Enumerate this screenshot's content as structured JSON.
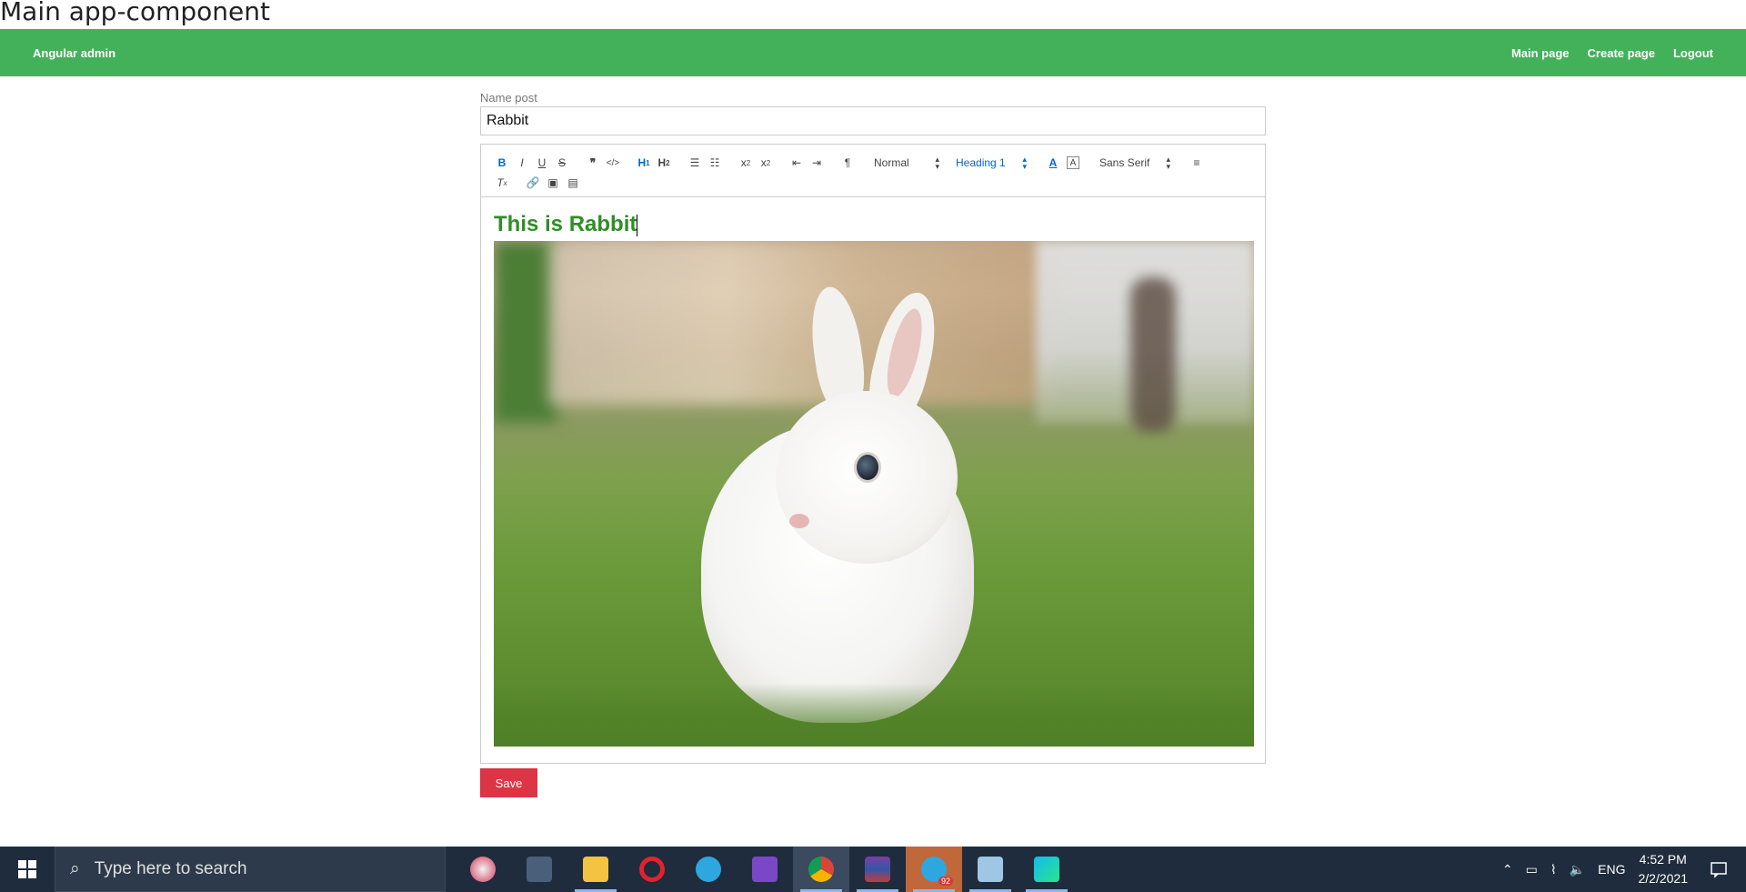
{
  "page": {
    "heading": "Main app-component"
  },
  "navbar": {
    "brand": "Angular admin",
    "links": [
      "Main page",
      "Create page",
      "Logout"
    ],
    "color": "#42b15a"
  },
  "form": {
    "name_label": "Name post",
    "name_value": "Rabbit"
  },
  "toolbar": {
    "size_select": "Normal",
    "header_select": "Heading 1",
    "font_select": "Sans Serif",
    "buttons": [
      "bold-icon",
      "italic-icon",
      "underline-icon",
      "strike-icon",
      "blockquote-icon",
      "code-block-icon",
      "header1-icon",
      "header2-icon",
      "ordered-list-icon",
      "bullet-list-icon",
      "subscript-icon",
      "superscript-icon",
      "outdent-icon",
      "indent-icon",
      "text-direction-icon",
      "color-icon",
      "background-icon",
      "align-icon",
      "clean-icon",
      "link-icon",
      "image-icon",
      "video-icon"
    ]
  },
  "editor": {
    "heading_text": "This is Rabbit",
    "heading_color": "#2f8e26"
  },
  "save": {
    "label": "Save",
    "color": "#dc3545"
  },
  "taskbar": {
    "search_placeholder": "Type here to search",
    "apps": [
      "paint-icon",
      "calculator-icon",
      "file-explorer-icon",
      "opera-icon",
      "telegram-icon",
      "visual-studio-icon",
      "chrome-icon",
      "winrar-icon",
      "telegram-desktop-icon",
      "notepad-icon",
      "webstorm-icon"
    ],
    "telegram_badge": "92",
    "language": "ENG",
    "time": "4:52 PM",
    "date": "2/2/2021"
  }
}
